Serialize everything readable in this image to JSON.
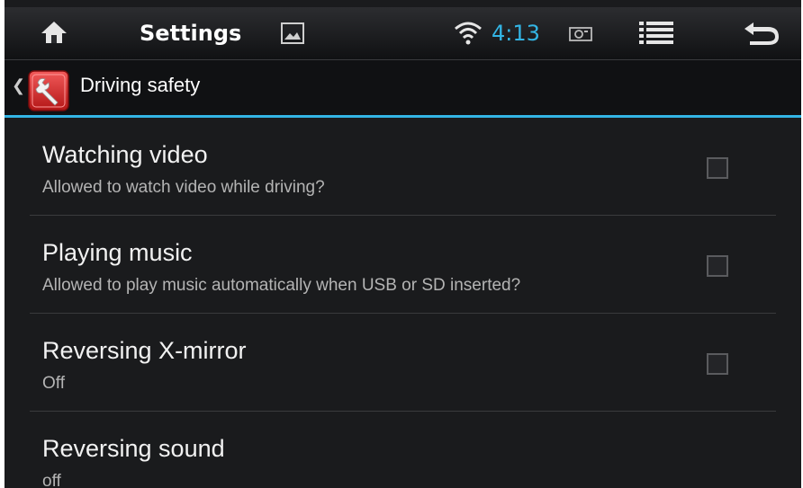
{
  "status_bar": {
    "title": "Settings",
    "time": "4:13",
    "icons": [
      "home-icon",
      "gallery-icon",
      "wifi-icon",
      "camera-icon",
      "menu-icon",
      "back-icon"
    ]
  },
  "action_bar": {
    "title": "Driving safety",
    "icon": "wrench-settings-icon"
  },
  "colors": {
    "accent": "#33b5e5",
    "background": "#1a1b1d"
  },
  "settings": [
    {
      "title": "Watching video",
      "summary": "Allowed to watch video while driving?",
      "checked": false
    },
    {
      "title": "Playing music",
      "summary": "Allowed to play music automatically when USB or SD inserted?",
      "checked": false
    },
    {
      "title": "Reversing X-mirror",
      "summary": "Off",
      "checked": false
    },
    {
      "title": "Reversing sound",
      "summary": "off"
    }
  ]
}
